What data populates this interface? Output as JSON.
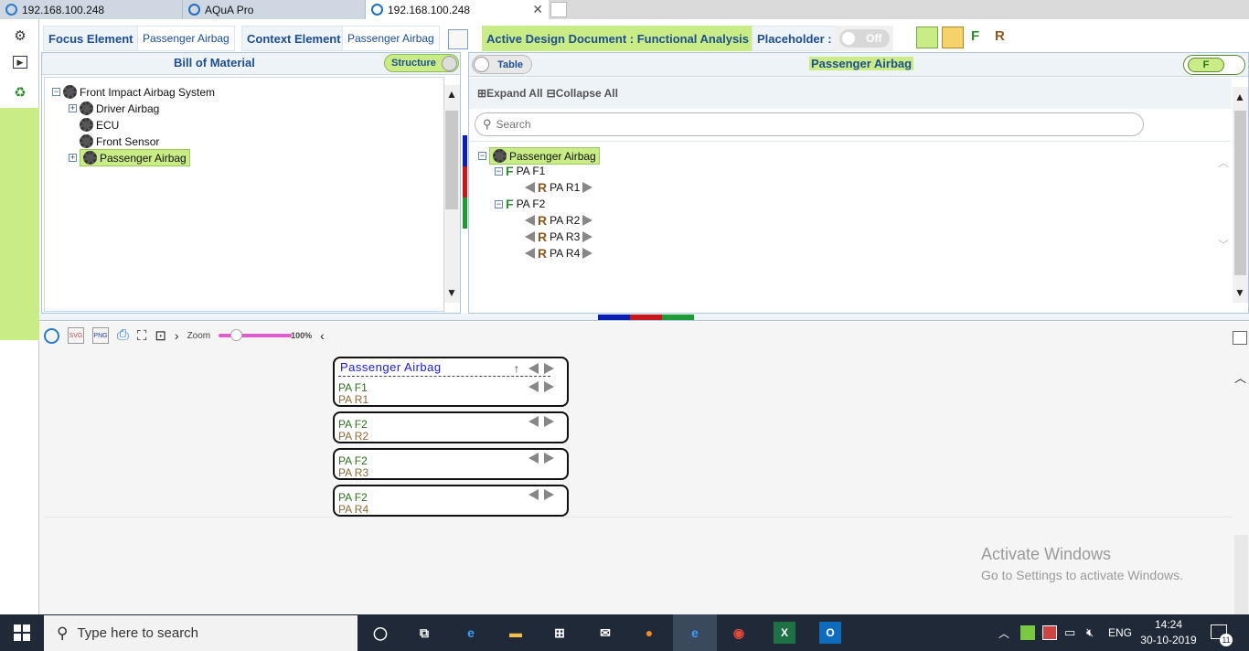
{
  "browser_tabs": [
    {
      "label": "192.168.100.248"
    },
    {
      "label": "AQuA Pro"
    },
    {
      "label": "192.168.100.248"
    }
  ],
  "header": {
    "focus_label": "Focus Element :",
    "focus_value": "Passenger Airbag",
    "context_label": "Context Element",
    "context_value": "Passenger Airbag",
    "active_doc": "Active Design Document : Functional Analysis",
    "placeholder_label": "Placeholder :",
    "placeholder_toggle": "Off",
    "f_label": "F",
    "r_label": "R"
  },
  "bom": {
    "title": "Bill of Material",
    "toggle_label": "Structure",
    "items": [
      {
        "label": "Front Impact Airbag System"
      },
      {
        "label": "Driver Airbag"
      },
      {
        "label": "ECU"
      },
      {
        "label": "Front Sensor"
      },
      {
        "label": "Passenger Airbag"
      }
    ]
  },
  "analysis": {
    "table_toggle": "Table",
    "title": "Passenger Airbag",
    "f_toggle": "F",
    "expand_all": "Expand All",
    "collapse_all": "Collapse All",
    "search_placeholder": "Search",
    "root": "Passenger Airbag",
    "f_nodes": [
      {
        "letter": "F",
        "label": "PA F1",
        "r_nodes": [
          {
            "letter": "R",
            "label": "PA R1"
          }
        ]
      },
      {
        "letter": "F",
        "label": "PA F2",
        "r_nodes": [
          {
            "letter": "R",
            "label": "PA R2"
          },
          {
            "letter": "R",
            "label": "PA R3"
          },
          {
            "letter": "R",
            "label": "PA R4"
          }
        ]
      }
    ]
  },
  "diagram_toolbar": {
    "zoom_label": "Zoom",
    "zoom_value": "100%",
    "svg_label": "SVG",
    "png_label": "PNG",
    "zoom_percent": 100
  },
  "cards": {
    "title": "Passenger Airbag",
    "rows": [
      {
        "f": "PA F1",
        "r": "PA R1"
      },
      {
        "f": "PA F2",
        "r": "PA R2"
      },
      {
        "f": "PA F2",
        "r": "PA R3"
      },
      {
        "f": "PA F2",
        "r": "PA R4"
      }
    ]
  },
  "watermark": {
    "line1": "Activate Windows",
    "line2": "Go to Settings to activate Windows."
  },
  "taskbar": {
    "search_placeholder": "Type here to search",
    "language": "ENG",
    "time": "14:24",
    "date": "30-10-2019",
    "notifications": "11"
  },
  "colors": {
    "accent_green": "#c9ec86",
    "title_blue": "#1d4e8f",
    "f_green": "#2e8b2e",
    "r_brown": "#8a5a22"
  }
}
